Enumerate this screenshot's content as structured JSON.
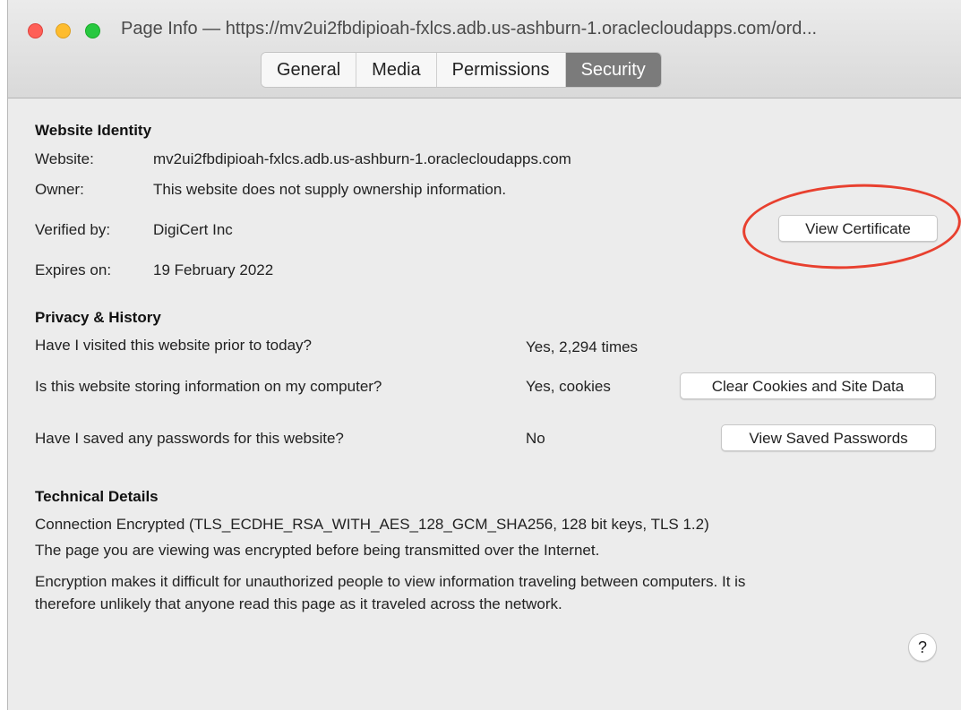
{
  "window": {
    "title": "Page Info — https://mv2ui2fbdipioah-fxlcs.adb.us-ashburn-1.oraclecloudapps.com/ord...",
    "tabs": [
      {
        "label": "General",
        "active": false
      },
      {
        "label": "Media",
        "active": false
      },
      {
        "label": "Permissions",
        "active": false
      },
      {
        "label": "Security",
        "active": true
      }
    ]
  },
  "identity": {
    "heading": "Website Identity",
    "website_label": "Website:",
    "website_value": "mv2ui2fbdipioah-fxlcs.adb.us-ashburn-1.oraclecloudapps.com",
    "owner_label": "Owner:",
    "owner_value": "This website does not supply ownership information.",
    "verified_label": "Verified by:",
    "verified_value": "DigiCert Inc",
    "expires_label": "Expires on:",
    "expires_value": "19 February 2022",
    "view_certificate": "View Certificate"
  },
  "privacy": {
    "heading": "Privacy & History",
    "visited_q": "Have I visited this website prior to today?",
    "visited_a": "Yes, 2,294 times",
    "storing_q": "Is this website storing information on my computer?",
    "storing_a": "Yes, cookies",
    "clear_cookies": "Clear Cookies and Site Data",
    "passwords_q": "Have I saved any passwords for this website?",
    "passwords_a": "No",
    "view_passwords": "View Saved Passwords"
  },
  "technical": {
    "heading": "Technical Details",
    "line1": "Connection Encrypted (TLS_ECDHE_RSA_WITH_AES_128_GCM_SHA256, 128 bit keys, TLS 1.2)",
    "line2": "The page you are viewing was encrypted before being transmitted over the Internet.",
    "line3": "Encryption makes it difficult for unauthorized people to view information traveling between computers. It is",
    "line4": "therefore unlikely that anyone read this page as it traveled across the network."
  },
  "help_label": "?",
  "colors": {
    "annotation": "#e8402f",
    "active_tab": "#7b7b7b",
    "close": "#fe5f57",
    "minimize": "#febc2e",
    "zoom": "#28c840"
  }
}
